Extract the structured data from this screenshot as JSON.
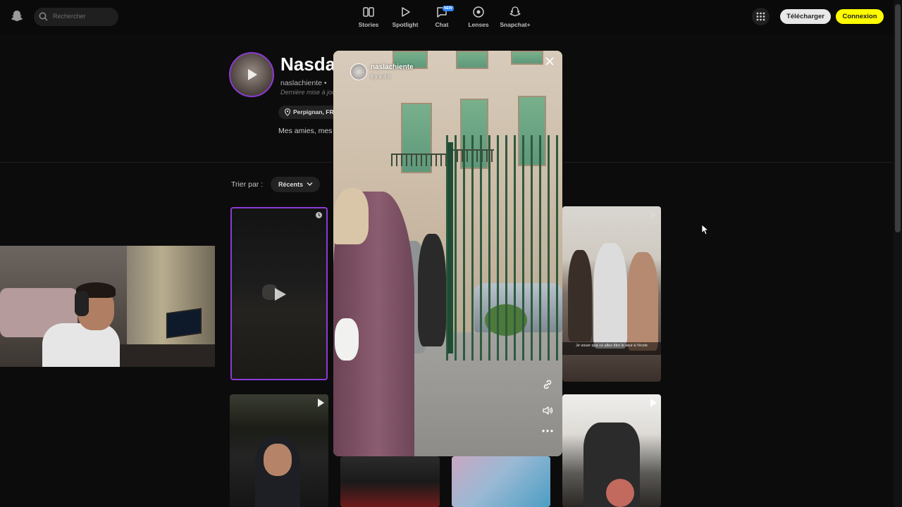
{
  "search": {
    "placeholder": "Rechercher"
  },
  "nav": [
    {
      "label": "Stories",
      "icon": "stories-icon"
    },
    {
      "label": "Spotlight",
      "icon": "spotlight-play-icon"
    },
    {
      "label": "Chat",
      "icon": "chat-icon",
      "badge": "NEW"
    },
    {
      "label": "Lenses",
      "icon": "lenses-icon"
    },
    {
      "label": "Snapchat+",
      "icon": "snapchat-plus-icon"
    }
  ],
  "header": {
    "download_label": "Télécharger",
    "login_label": "Connexion",
    "accent_yellow": "#fffc00"
  },
  "profile": {
    "display_name": "Nasdas",
    "username": "naslachiente •",
    "updated": "Dernière mise à jour",
    "location": "Perpignan, FR",
    "bio": "Mes amies, mes"
  },
  "sort": {
    "label": "Trier par :",
    "value": "Récents"
  },
  "tiles": {
    "caption": "Je vouer que ce allez être le seul à l'école"
  },
  "story": {
    "username": "naslachiente",
    "time": "Il y a 3 h"
  },
  "colors": {
    "story_ring": "#8c3bd4",
    "background": "#0c0c0c"
  }
}
